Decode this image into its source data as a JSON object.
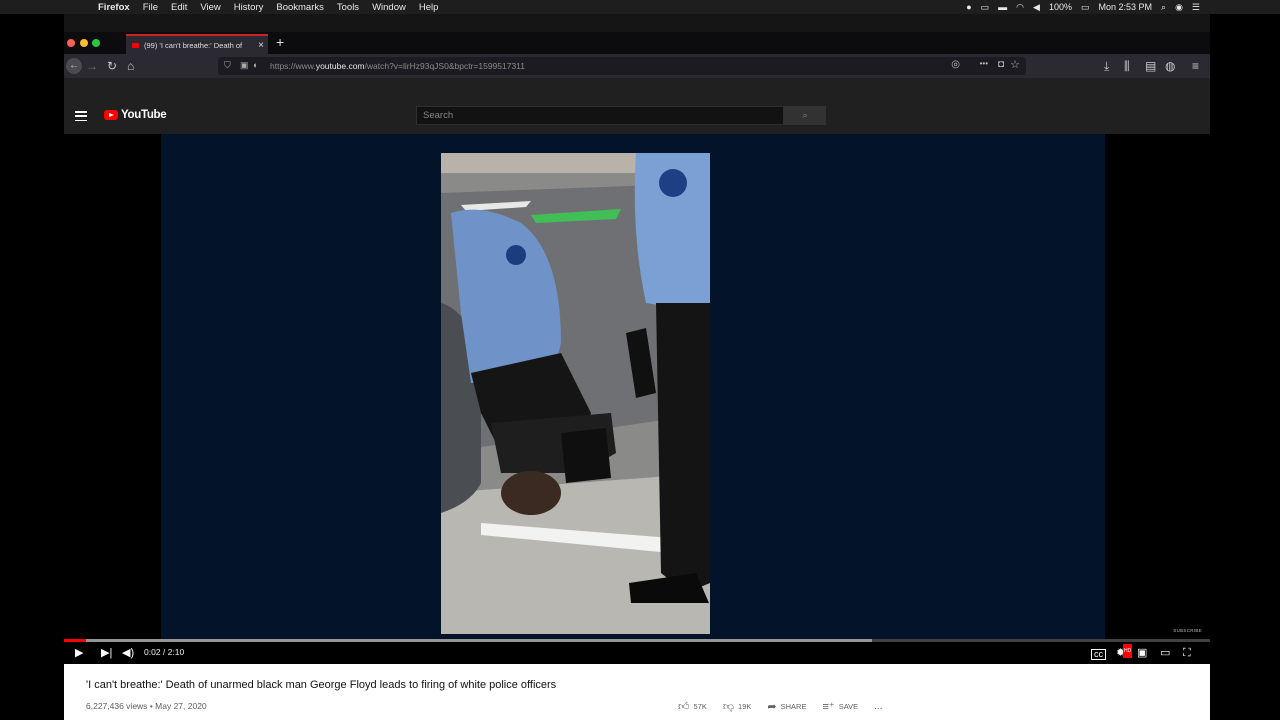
{
  "menubar": {
    "apple": "",
    "app_name": "Firefox",
    "items": [
      "File",
      "Edit",
      "View",
      "History",
      "Bookmarks",
      "Tools",
      "Window",
      "Help"
    ],
    "battery": "100%",
    "clock": "Mon 2:53 PM"
  },
  "tab": {
    "title": "(99) 'I can't breathe:' Death of",
    "close": "×",
    "new_tab": "+"
  },
  "nav": {
    "back": "←",
    "forward": "→",
    "reload": "↻",
    "home": "⌂",
    "url_prefix": "https://www.",
    "url_domain": "youtube.com",
    "url_path": "/watch?v=lirHz93qJS0&bpctr=1599517311",
    "page_actions": "•••",
    "menu": "≡"
  },
  "youtube": {
    "logo_text": "YouTube",
    "search_placeholder": "Search",
    "search_icon": "search-icon"
  },
  "player": {
    "current_time": "0:02",
    "duration": "2:10",
    "time_display": "0:02 / 2:10",
    "subscribe_watermark": "SUBSCRIBE",
    "played_fraction": 0.019,
    "buffered_fraction": 0.705,
    "progress_color": "#ff0000",
    "hd_badge": "HD"
  },
  "video": {
    "title": "'I can't breathe:' Death of unarmed black man George Floyd leads to firing of white police officers",
    "views": "6,227,436 views",
    "date": "May 27, 2020",
    "likes": "57K",
    "dislikes": "19K",
    "share_label": "SHARE",
    "save_label": "SAVE",
    "more": "..."
  }
}
